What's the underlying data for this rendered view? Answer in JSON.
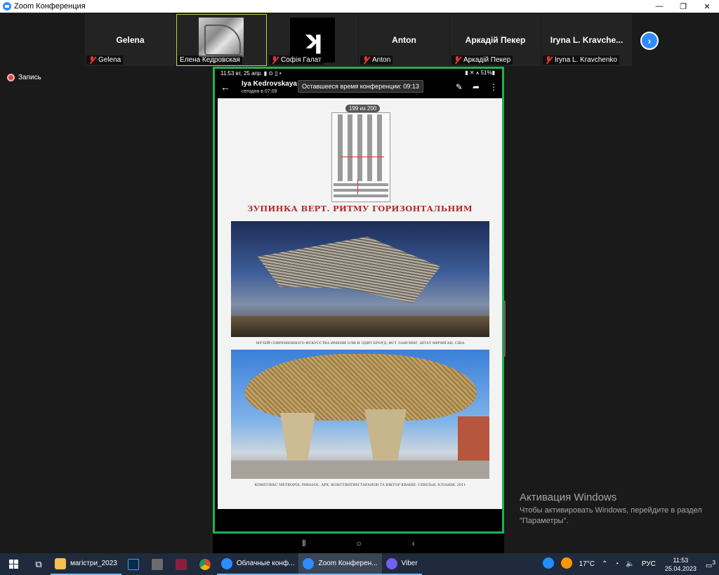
{
  "window": {
    "title": "Zoom Конференция",
    "controls": [
      "—",
      "❐",
      "✕"
    ]
  },
  "participants": [
    {
      "name": "Gelena",
      "label": "Gelena",
      "kind": "name"
    },
    {
      "name": "",
      "label": "Елена Кедровская",
      "kind": "photo",
      "active": true
    },
    {
      "name": "",
      "label": "Софія Галат",
      "kind": "logo",
      "logo_text": "ʞ"
    },
    {
      "name": "Anton",
      "label": "Anton",
      "kind": "name"
    },
    {
      "name": "Аркадій Пекер",
      "label": "Аркадій Пекер",
      "kind": "name"
    },
    {
      "name": "Iryna L. Kravche...",
      "label": "Iryna L. Kravchenko",
      "kind": "name"
    }
  ],
  "next_button": "›",
  "record": {
    "label": "Запись"
  },
  "share": {
    "status_bar": {
      "left": "11:53  вт, 25 апр.  ▮ ⊙ ▯  •",
      "right": "▮ ✕ ⩚ 51%▮"
    },
    "header": {
      "back": "←",
      "sender": "Iya Kedrovskaya",
      "time": "сегодня в 07:09",
      "tools": [
        "✎",
        "➦",
        "⋮"
      ]
    },
    "tooltip": "Оставшееся время конференции: 09:13",
    "slide": {
      "page_counter": "199 из 200",
      "heading": "ЗУПИНКА ВЕРТ. РИТМУ ГОРИЗОНТАЛЬНИМ",
      "caption1": "МУЗЕЙ СОВРЕМЕННОГО ИСКУССТВА ИМЕНИ ЭЛИ И ЭДИТ БРОУД. ИСТ ЛАНСИНГ, ШТАТ МИЧИГАН, США",
      "caption2": "КОМПЛЕКС METROPOL PARASOL. АРХ. КОНСТЯНТИН ТАРАНОВ ТА ВІКТОР КВАШЕ. СЕВІЛЬЯ, ІСПАНІЯ, 2011"
    },
    "nav": [
      "⦀",
      "○",
      "‹"
    ]
  },
  "activation": {
    "title": "Активация Windows",
    "text": "Чтобы активировать Windows, перейдите в раздел \"Параметры\"."
  },
  "taskbar": {
    "apps": [
      {
        "label": "магістри_2023",
        "color": "#f2c14e"
      },
      {
        "label": "Облачные конф...",
        "color": "#2d8cff"
      },
      {
        "label": "Zoom Конферен...",
        "color": "#2d8cff",
        "focused": true
      },
      {
        "label": "Viber",
        "color": "#7360f2"
      }
    ],
    "weather": "17°C",
    "lang": "РУС",
    "time": "11:53",
    "date": "25.04.2023",
    "notifications": "3"
  }
}
